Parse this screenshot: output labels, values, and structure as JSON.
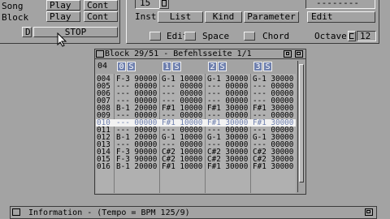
{
  "transport": {
    "rows": [
      {
        "label": "Song",
        "play": "Play",
        "cont": "Cont"
      },
      {
        "label": "Block",
        "play": "Play",
        "cont": "Cont"
      }
    ],
    "d_label": "D",
    "stop_label": "STOP"
  },
  "instrument_panel": {
    "number": "15",
    "inst_label": "Inst:",
    "buttons": [
      "List",
      "Kind",
      "Parameter",
      "Edit"
    ],
    "name_field": "--------",
    "options": [
      "Edit",
      "Space",
      "Chord"
    ],
    "octave_label": "Octave",
    "octave_value": "12"
  },
  "block_window": {
    "title": "Block 29/51 - Befehlsseite 1/1",
    "lines_count": "04",
    "tracks": [
      {
        "num": "0",
        "s": "S"
      },
      {
        "num": "1",
        "s": "S"
      },
      {
        "num": "2",
        "s": "S"
      },
      {
        "num": "3",
        "s": "S"
      }
    ],
    "rows": [
      {
        "line": "004",
        "cells": [
          "F-3 90000",
          "G-1 10000",
          "G-1 30000",
          "G-1 30000"
        ],
        "current": false
      },
      {
        "line": "005",
        "cells": [
          "--- 00000",
          "--- 00000",
          "--- 00000",
          "--- 00000"
        ],
        "current": false
      },
      {
        "line": "006",
        "cells": [
          "--- 00000",
          "--- 00000",
          "--- 00000",
          "--- 00000"
        ],
        "current": false
      },
      {
        "line": "007",
        "cells": [
          "--- 00000",
          "--- 00000",
          "--- 00000",
          "--- 00000"
        ],
        "current": false
      },
      {
        "line": "008",
        "cells": [
          "B-1 20000",
          "F#1 10000",
          "F#1 30000",
          "F#1 30000"
        ],
        "current": false
      },
      {
        "line": "009",
        "cells": [
          "--- 00000",
          "--- 00000",
          "--- 00000",
          "--- 00000"
        ],
        "current": false
      },
      {
        "line": "010",
        "cells": [
          "--- 00000",
          "F#1 10000",
          "F#1 30000",
          "F#1 30000"
        ],
        "current": true
      },
      {
        "line": "011",
        "cells": [
          "--- 00000",
          "--- 00000",
          "--- 00000",
          "--- 00000"
        ],
        "current": false
      },
      {
        "line": "012",
        "cells": [
          "B-1 20000",
          "G-1 10000",
          "G-1 30000",
          "G-1 30000"
        ],
        "current": false
      },
      {
        "line": "013",
        "cells": [
          "--- 00000",
          "--- 00000",
          "--- 00000",
          "--- 00000"
        ],
        "current": false
      },
      {
        "line": "014",
        "cells": [
          "F-3 90000",
          "C#2 10000",
          "C#2 30000",
          "C#2 30000"
        ],
        "current": false
      },
      {
        "line": "015",
        "cells": [
          "F-3 90000",
          "C#2 10000",
          "C#2 30000",
          "C#2 30000"
        ],
        "current": false
      },
      {
        "line": "016",
        "cells": [
          "B-1 20000",
          "F#1 10000",
          "F#1 30000",
          "F#1 30000"
        ],
        "current": false
      }
    ]
  },
  "info_bar": {
    "text": "Information - (Tempo = BPM 125/9)"
  },
  "colors": {
    "background": "#a3a3a3",
    "highlight": "#f2f2f2",
    "shadow": "#3b3b3b",
    "accent": "#6f80ae"
  },
  "icons": [
    "depth-gadget-icon",
    "zoom-gadget-icon",
    "close-gadget-icon",
    "checkbox-icon",
    "mouse-pointer-icon"
  ]
}
